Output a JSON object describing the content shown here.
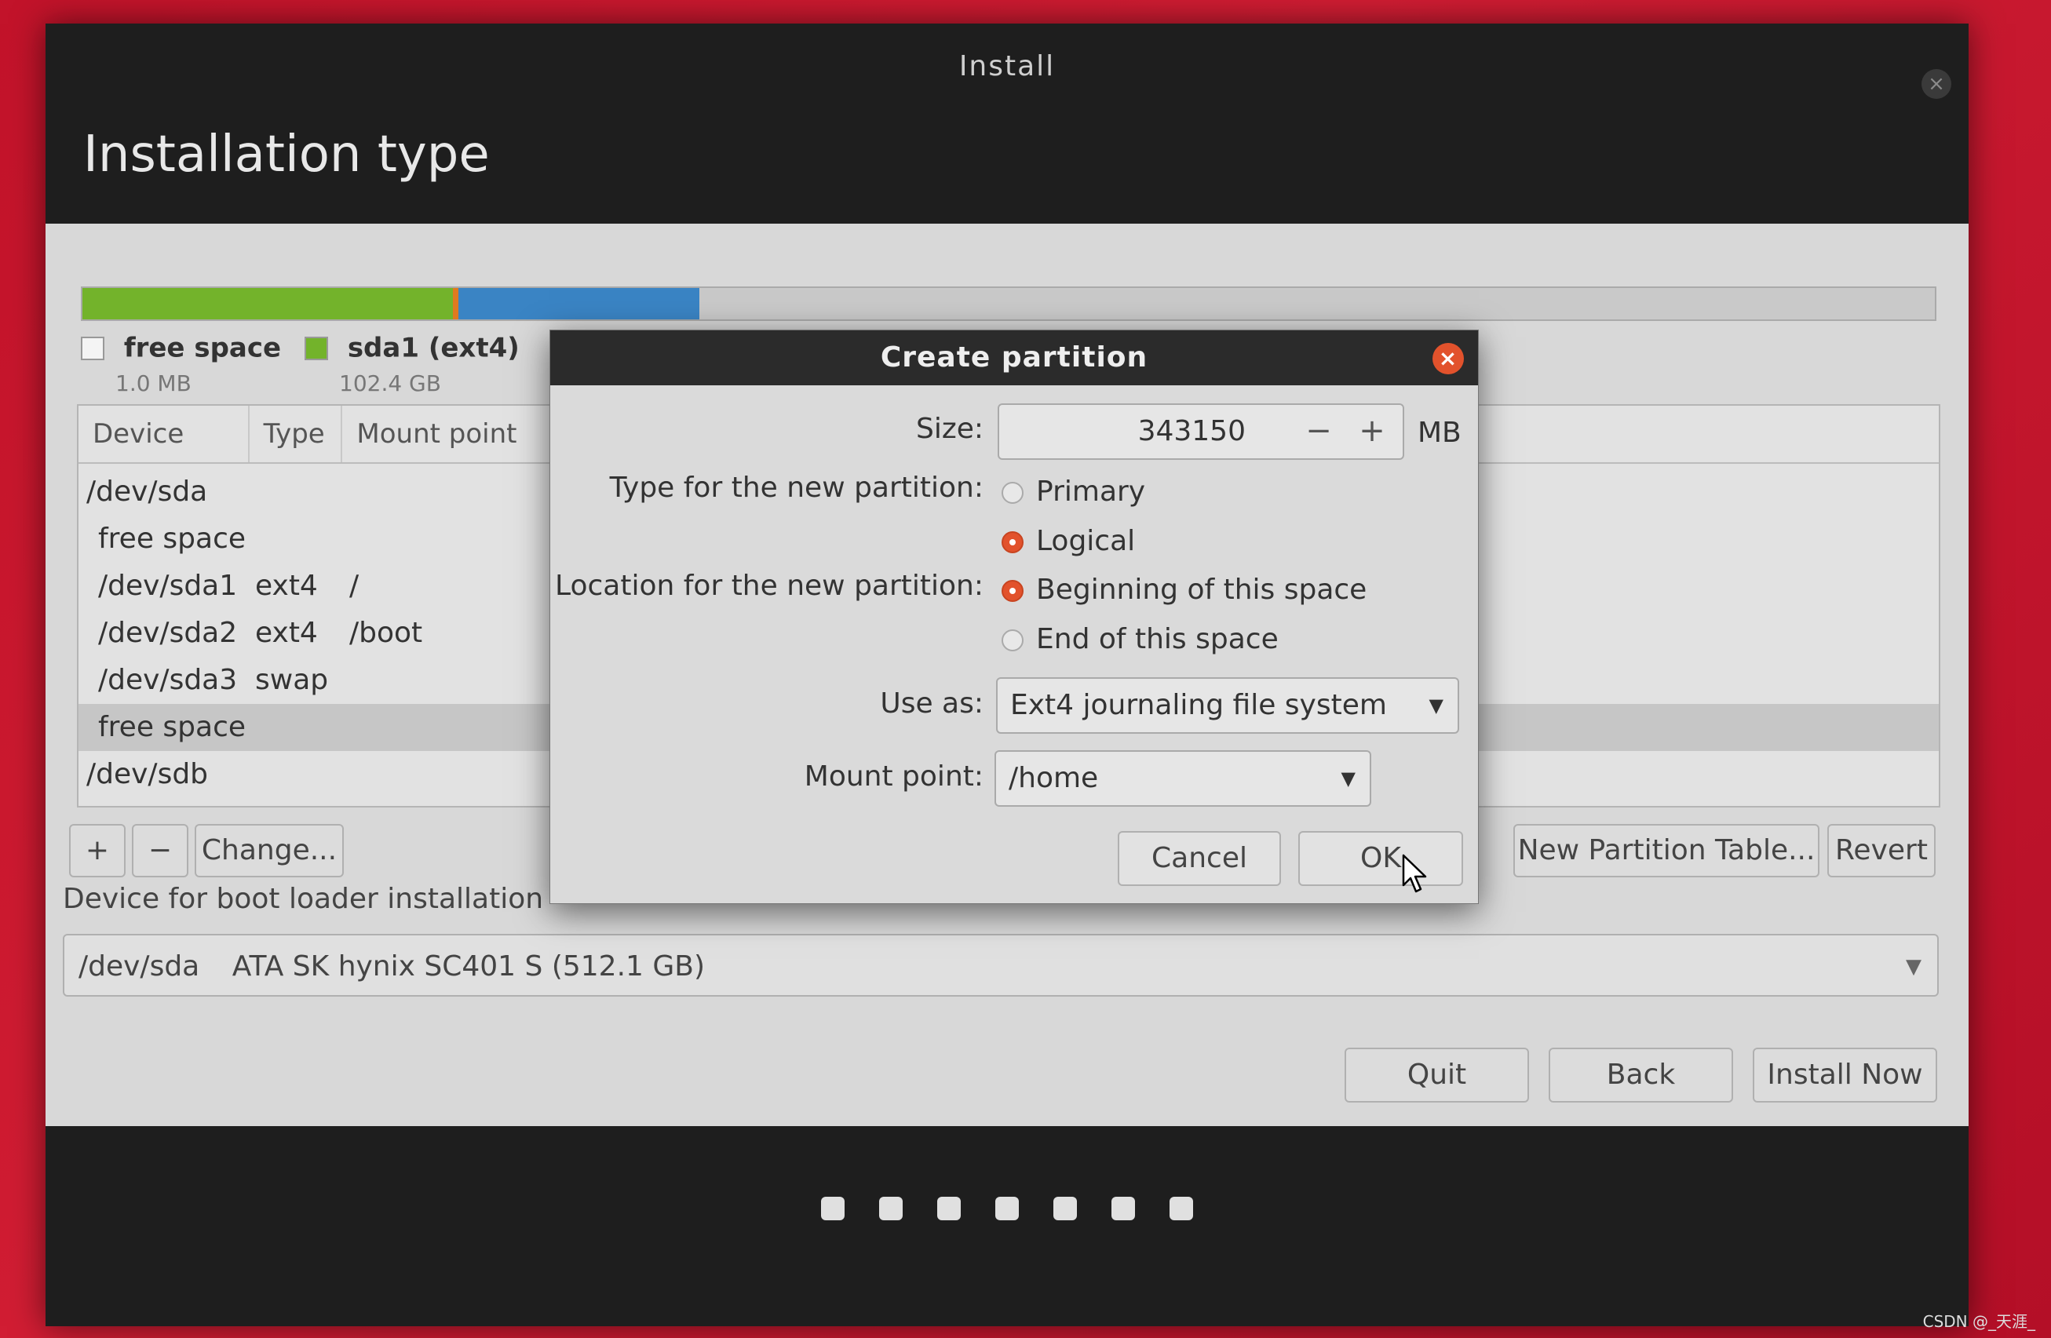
{
  "window": {
    "title": "Install",
    "close_icon": "close-icon"
  },
  "page": {
    "title": "Installation type"
  },
  "partition_bar": {
    "segments": [
      {
        "name": "sda1",
        "color": "#73b32b",
        "fraction": 0.2
      },
      {
        "name": "sda2",
        "color": "#e07a1f",
        "fraction": 0.002
      },
      {
        "name": "sda3",
        "color": "#3a84c4",
        "fraction": 0.13
      },
      {
        "name": "free",
        "color": "#c9c9c9",
        "fraction": 0.668
      }
    ]
  },
  "legend": [
    {
      "name": "free space",
      "size": "1.0 MB",
      "color": "#ffffff"
    },
    {
      "name": "sda1 (ext4)",
      "size": "102.4 GB",
      "color": "#73b32b"
    }
  ],
  "table": {
    "headers": [
      "Device",
      "Type",
      "Mount point"
    ],
    "rows": [
      {
        "device": "/dev/sda",
        "type": "",
        "mount": ""
      },
      {
        "device": "free space",
        "type": "",
        "mount": ""
      },
      {
        "device": "/dev/sda1",
        "type": "ext4",
        "mount": "/"
      },
      {
        "device": "/dev/sda2",
        "type": "ext4",
        "mount": "/boot"
      },
      {
        "device": "/dev/sda3",
        "type": "swap",
        "mount": ""
      },
      {
        "device": "free space",
        "type": "",
        "mount": ""
      },
      {
        "device": "/dev/sdb",
        "type": "",
        "mount": ""
      }
    ],
    "selected_index": 5
  },
  "table_buttons": {
    "add": "+",
    "remove": "−",
    "change": "Change...",
    "new_table": "New Partition Table...",
    "revert": "Revert"
  },
  "boot_loader": {
    "label": "Device for boot loader installation",
    "device": "/dev/sda",
    "description": "ATA SK hynix SC401 S (512.1 GB)"
  },
  "footer_buttons": {
    "quit": "Quit",
    "back": "Back",
    "install_now": "Install Now"
  },
  "progress_dots": 7,
  "dialog": {
    "title": "Create partition",
    "size_label": "Size:",
    "size_value": "343150",
    "size_unit": "MB",
    "minus": "−",
    "plus": "+",
    "type_label": "Type for the new partition:",
    "type_options": [
      "Primary",
      "Logical"
    ],
    "type_selected": "Logical",
    "location_label": "Location for the new partition:",
    "location_options": [
      "Beginning of this space",
      "End of this space"
    ],
    "location_selected": "Beginning of this space",
    "use_as_label": "Use as:",
    "use_as_value": "Ext4 journaling file system",
    "mount_label": "Mount point:",
    "mount_value": "/home",
    "cancel": "Cancel",
    "ok": "OK"
  },
  "watermark": "CSDN @_天涯_"
}
